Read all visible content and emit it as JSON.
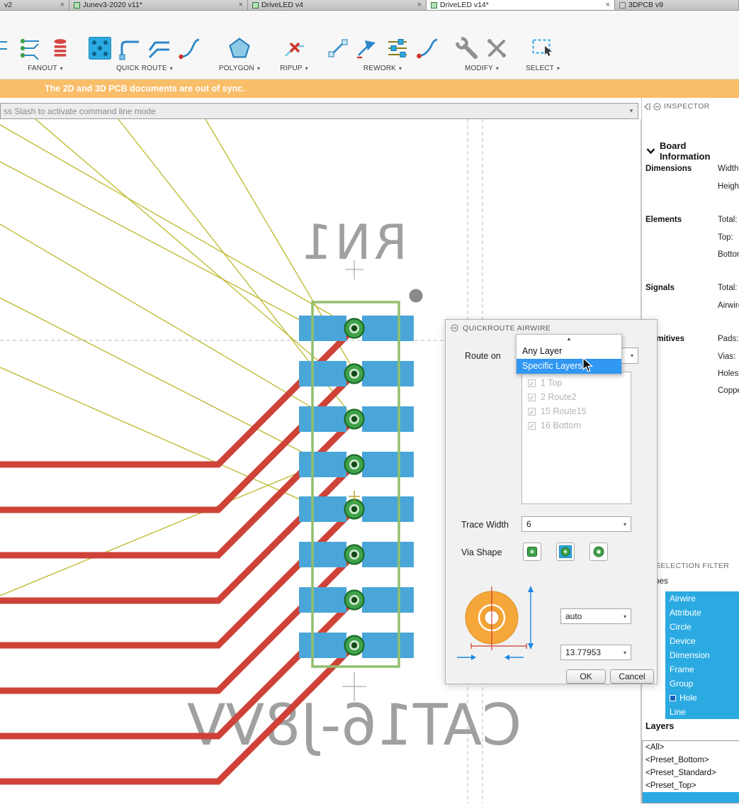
{
  "ui": {
    "caret": "▾",
    "check": "✓",
    "scroll_up": "▲",
    "close": "×"
  },
  "tabs": [
    {
      "label": "v2"
    },
    {
      "label": "Junev3-2020 v11*"
    },
    {
      "label": "DriveLED v4"
    },
    {
      "label": "DriveLED v14*"
    },
    {
      "label": "3DPCB v9"
    }
  ],
  "toolbar": {
    "groups": [
      {
        "label": "FANOUT"
      },
      {
        "label": "QUICK ROUTE"
      },
      {
        "label": "POLYGON"
      },
      {
        "label": "RIPUP"
      },
      {
        "label": "REWORK"
      },
      {
        "label": "MODIFY"
      },
      {
        "label": "SELECT"
      }
    ]
  },
  "banner": {
    "text": "The 2D and 3D PCB documents are out of sync."
  },
  "command_bar": {
    "text": "ss Slash to activate command line mode"
  },
  "inspector": {
    "title": "INSPECTOR",
    "section_title": "Board Information",
    "dimensions_label": "Dimensions",
    "dimensions_fields": [
      "Width:",
      "Height:"
    ],
    "elements_label": "Elements",
    "elements_fields": [
      "Total:",
      "Top:",
      "Bottom:"
    ],
    "signals_label": "Signals",
    "signals_fields": [
      "Total:",
      "Airwires:"
    ],
    "primitives_label": "Primitives",
    "primitives_fields": [
      "Pads:",
      "Vias:",
      "Holes:",
      "Copper:"
    ]
  },
  "selection_filter": {
    "title": "SELECTION FILTER",
    "subtitle": "Types",
    "types": [
      "Airwire",
      "Attribute",
      "Circle",
      "Device",
      "Dimension",
      "Frame",
      "Group",
      "Hole",
      "Line"
    ],
    "layers_label": "Layers",
    "layer_presets": [
      "<All>",
      "<Preset_Bottom>",
      "<Preset_Standard>",
      "<Preset_Top>"
    ]
  },
  "dialog": {
    "title": "QUICKROUTE AIRWIRE",
    "route_on_label": "Route on",
    "route_options": [
      "Any Layer",
      "Specific Layers"
    ],
    "selected_route_option": "Specific Layers",
    "layer_checklist": [
      "1 Top",
      "2 Route2",
      "15 Route15",
      "16 Bottom"
    ],
    "trace_width_label": "Trace Width",
    "trace_width_value": "6",
    "via_shape_label": "Via Shape",
    "via_diameter_value": "auto",
    "via_drill_value": "13.77953",
    "ok_label": "OK",
    "cancel_label": "Cancel"
  },
  "pcb": {
    "component_name": "RN1",
    "component_value": "CAT16-J8VV"
  },
  "colors": {
    "accent_blue": "#2baae2",
    "selection_blue": "#3097f3",
    "trace_red": "#ce4237",
    "pad_blue": "#4aa6d8",
    "via_green": "#3fa24a",
    "outline_green": "#92bf6d",
    "airwire_yellow": "#bdb82a",
    "warning_orange": "#f9be6a",
    "via_preview_orange": "#f6a73a",
    "silkscreen_gray": "#a0a0a0"
  }
}
